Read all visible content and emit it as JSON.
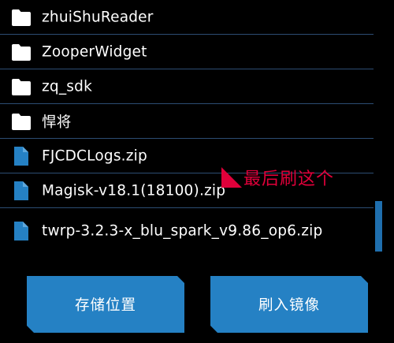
{
  "file_list": {
    "items": [
      {
        "type": "folder",
        "icon": "folder-icon",
        "name": "zhuiShuReader"
      },
      {
        "type": "folder",
        "icon": "folder-icon",
        "name": "ZooperWidget"
      },
      {
        "type": "folder",
        "icon": "folder-icon",
        "name": "zq_sdk"
      },
      {
        "type": "folder",
        "icon": "folder-icon",
        "name": "悍将"
      },
      {
        "type": "file",
        "icon": "zip-file-icon",
        "name": "FJCDCLogs.zip"
      },
      {
        "type": "file",
        "icon": "zip-file-icon",
        "name": "Magisk-v18.1(18100).zip"
      },
      {
        "type": "file",
        "icon": "zip-file-icon",
        "name": "twrp-3.2.3-x_blu_spark_v9.86_op6.zip"
      }
    ]
  },
  "annotation": {
    "text": "最后刷这个",
    "color": "#e0003a"
  },
  "buttons": {
    "storage_label": "存储位置",
    "flash_label": "刷入镜像"
  },
  "colors": {
    "accent": "#2581c4",
    "divider": "#2c4d73",
    "background": "#000000"
  }
}
